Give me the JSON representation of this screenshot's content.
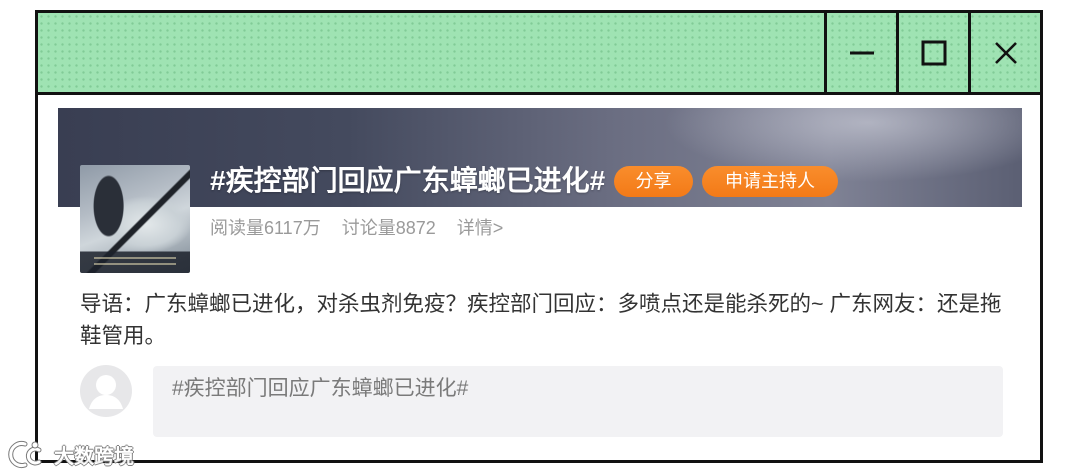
{
  "icons": {
    "minimize": "minimize-icon",
    "maximize": "maximize-icon",
    "close": "close-icon",
    "avatar": "default-avatar-icon",
    "watermark_logo": "watermark-logo-icon"
  },
  "colors": {
    "title_bar": "#9fe3b3",
    "frame": "#111111",
    "banner": "#3a3f53",
    "accent_orange": "#f5821f",
    "title_text": "#ffffff",
    "meta_text": "#9a9a9a",
    "body_text": "#333333",
    "composer_bg": "#f2f2f4",
    "composer_text": "#7a7a7a"
  },
  "topic": {
    "title": "#疾控部门回应广东蟑螂已进化#",
    "actions": {
      "share": "分享",
      "apply_host": "申请主持人"
    },
    "stats": {
      "reads": "阅读量6117万",
      "discussions": "讨论量8872",
      "details_link": "详情>"
    },
    "intro": "导语：广东蟑螂已进化，对杀虫剂免疫？疾控部门回应：多喷点还是能杀死的~ 广东网友：还是拖鞋管用。"
  },
  "composer": {
    "value": "#疾控部门回应广东蟑螂已进化#"
  },
  "watermark": {
    "text": "大数跨境"
  }
}
